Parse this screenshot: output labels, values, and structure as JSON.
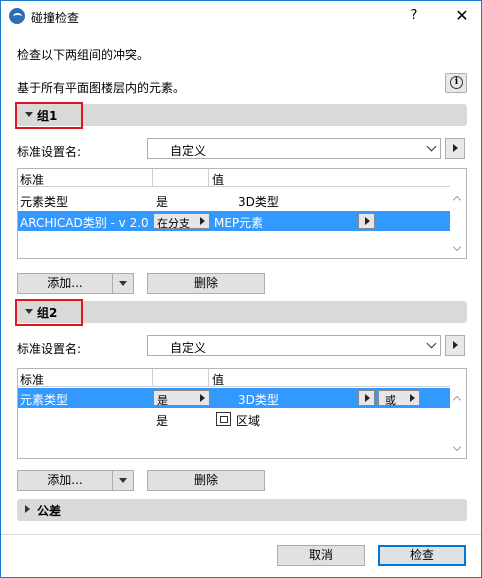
{
  "window": {
    "title": "碰撞检查",
    "help": "?",
    "close": "✕"
  },
  "intro": {
    "line1": "检查以下两组间的冲突。",
    "line2": "基于所有平面图楼层内的元素。"
  },
  "group1": {
    "title": "组1",
    "criteria_label": "标准设置名:",
    "criteria_value": "自定义",
    "table": {
      "col_criteria": "标准",
      "col_value": "值",
      "row1": {
        "c1": "元素类型",
        "c2": "是",
        "c3": "3D类型"
      },
      "row2": {
        "c1": "ARCHICAD类别 - v 2.0",
        "op": "在分支",
        "c3": "MEP元素"
      }
    },
    "add_label": "添加...",
    "delete_label": "删除"
  },
  "group2": {
    "title": "组2",
    "criteria_label": "标准设置名:",
    "criteria_value": "自定义",
    "table": {
      "col_criteria": "标准",
      "col_value": "值",
      "row1": {
        "c1": "元素类型",
        "op": "是",
        "c3": "3D类型",
        "logic": "或"
      },
      "row2": {
        "c2": "是",
        "c3": "区域"
      }
    },
    "add_label": "添加...",
    "delete_label": "删除"
  },
  "tolerance": {
    "title": "公差"
  },
  "footer": {
    "cancel": "取消",
    "check": "检查"
  },
  "colors": {
    "selection": "#3399ff",
    "highlight_box": "#e0161f",
    "group_bar": "#d9d9d9"
  }
}
